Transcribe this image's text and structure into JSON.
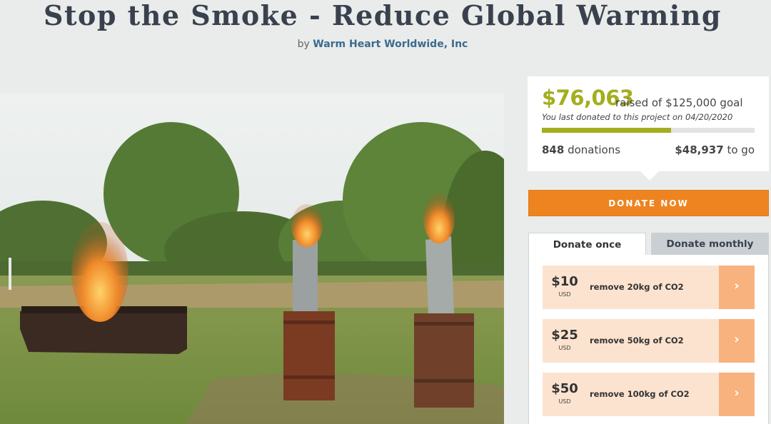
{
  "page": {
    "title": "Stop the Smoke - Reduce Global Warming",
    "by_prefix": "by",
    "organization": "Warm Heart Worldwide, Inc"
  },
  "funding": {
    "raised": "$76,063",
    "raised_suffix": "raised of $125,000 goal",
    "last_donated": "You last donated to this project on 04/20/2020",
    "progress_fraction": 0.6085,
    "donation_count": "848",
    "donation_label": "donations",
    "to_go_amount": "$48,937",
    "to_go_label": "to go"
  },
  "actions": {
    "donate_now": "DONATE NOW"
  },
  "tabs": {
    "once": "Donate once",
    "monthly": "Donate monthly"
  },
  "options": [
    {
      "amount": "$10",
      "currency": "USD",
      "description": "remove 20kg of CO2",
      "arrow": "›"
    },
    {
      "amount": "$25",
      "currency": "USD",
      "description": "remove 50kg of CO2",
      "arrow": "›"
    },
    {
      "amount": "$50",
      "currency": "USD",
      "description": "remove 100kg of CO2",
      "arrow": "›"
    }
  ],
  "colors": {
    "accent_green": "#a3ae1e",
    "donate_orange": "#ee8420",
    "option_bg": "#fce3cf",
    "option_arrow_bg": "#f7b27e"
  }
}
